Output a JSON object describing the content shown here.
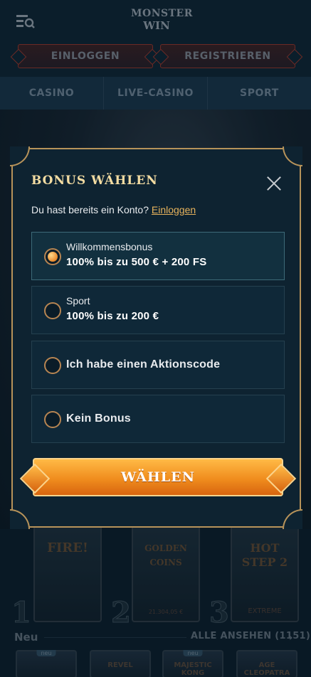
{
  "header": {
    "logo_line1": "MONSTER",
    "logo_line2": "WIN",
    "login_label": "EINLOGGEN",
    "register_label": "REGISTRIEREN"
  },
  "nav": {
    "items": [
      {
        "label": "CASINO"
      },
      {
        "label": "LIVE-CASINO"
      },
      {
        "label": "SPORT"
      }
    ]
  },
  "background": {
    "games": [
      {
        "title": "FIRE!",
        "sub": "",
        "rank": "1"
      },
      {
        "title": "GOLDEN COINS",
        "sub": "21.304,05 €",
        "rank": "2"
      },
      {
        "title": "HOT STEP 2",
        "sub": "EXTREME",
        "rank": "3"
      }
    ],
    "section_label": "Neu",
    "view_all_label": "ALLE ANSEHEN (1151)",
    "new_games": [
      {
        "tag": "neu",
        "title": ""
      },
      {
        "tag": "",
        "title": "REVEL"
      },
      {
        "tag": "neu",
        "title": "MAJESTIC KONG"
      },
      {
        "tag": "",
        "title": "AGE CLEOPATRA"
      }
    ]
  },
  "modal": {
    "title": "BONUS WÄHLEN",
    "account_prompt": "Du hast bereits ein Konto?",
    "account_link": "Einloggen",
    "options": [
      {
        "label": "Willkommensbonus",
        "value": "100% bis zu 500 € + 200 FS",
        "selected": true
      },
      {
        "label": "Sport",
        "value": "100% bis zu 200 €",
        "selected": false
      },
      {
        "label": "Ich habe einen Aktionscode",
        "value": "",
        "selected": false
      },
      {
        "label": "Kein Bonus",
        "value": "",
        "selected": false
      }
    ],
    "submit_label": "WÄHLEN"
  },
  "colors": {
    "accent": "#f08d1e",
    "title_gold": "#f3dca2",
    "link": "#e6b25c",
    "frame": "#b7935a"
  }
}
